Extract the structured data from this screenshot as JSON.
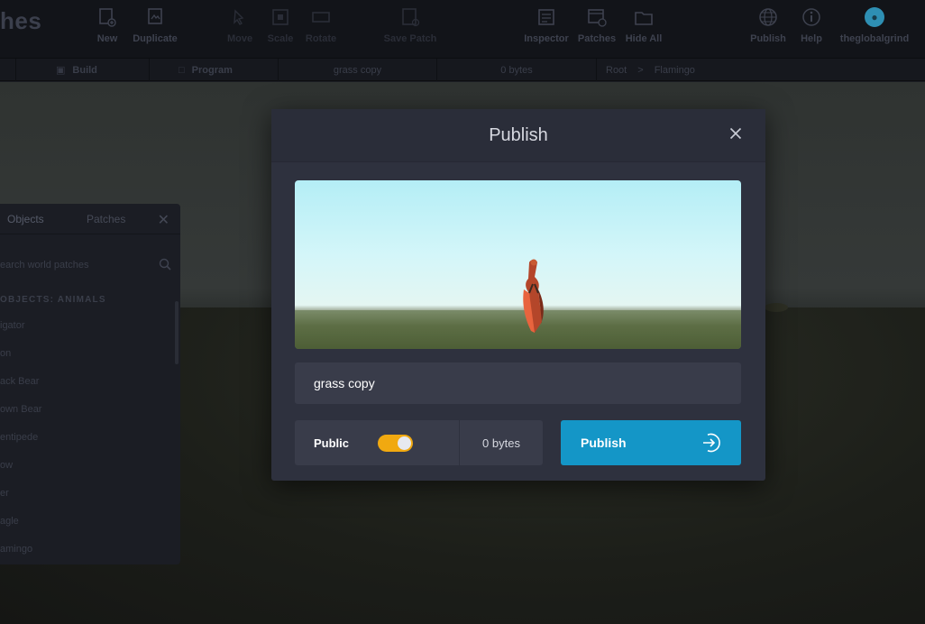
{
  "app": {
    "brand": "hes"
  },
  "toolbar": {
    "tools": [
      {
        "id": "new",
        "label": "New",
        "icon": "new-file-icon"
      },
      {
        "id": "duplicate",
        "label": "Duplicate",
        "icon": "duplicate-icon"
      },
      {
        "id": "move",
        "label": "Move",
        "icon": "move-icon"
      },
      {
        "id": "scale",
        "label": "Scale",
        "icon": "scale-icon"
      },
      {
        "id": "rotate",
        "label": "Rotate",
        "icon": "rotate-icon"
      },
      {
        "id": "save_patch",
        "label": "Save Patch",
        "icon": "save-patch-icon"
      },
      {
        "id": "inspector",
        "label": "Inspector",
        "icon": "inspector-icon"
      },
      {
        "id": "patches",
        "label": "Patches",
        "icon": "patches-icon"
      },
      {
        "id": "hide_all",
        "label": "Hide All",
        "icon": "hide-all-icon"
      },
      {
        "id": "publish",
        "label": "Publish",
        "icon": "globe-icon"
      },
      {
        "id": "help",
        "label": "Help",
        "icon": "info-icon"
      },
      {
        "id": "user",
        "label": "theglobalgrind",
        "icon": "avatar-icon"
      }
    ]
  },
  "subbar": {
    "build": "Build",
    "program": "Program",
    "world_name": "grass copy",
    "size": "0 bytes",
    "breadcrumb_root": "Root",
    "breadcrumb_sep": ">",
    "breadcrumb_leaf": "Flamingo"
  },
  "panel": {
    "tab_objects": "Objects",
    "tab_patches": "Patches",
    "search_placeholder": "earch world patches",
    "heading": "OBJECTS: ANIMALS",
    "items": [
      "igator",
      "on",
      "ack Bear",
      "own Bear",
      "entipede",
      "ow",
      "er",
      "agle",
      "amingo"
    ]
  },
  "modal": {
    "title": "Publish",
    "name_value": "grass copy",
    "public_label": "Public",
    "public_enabled": true,
    "size": "0 bytes",
    "publish_button": "Publish",
    "accent_color": "#1496c7",
    "toggle_color": "#f1a910"
  }
}
